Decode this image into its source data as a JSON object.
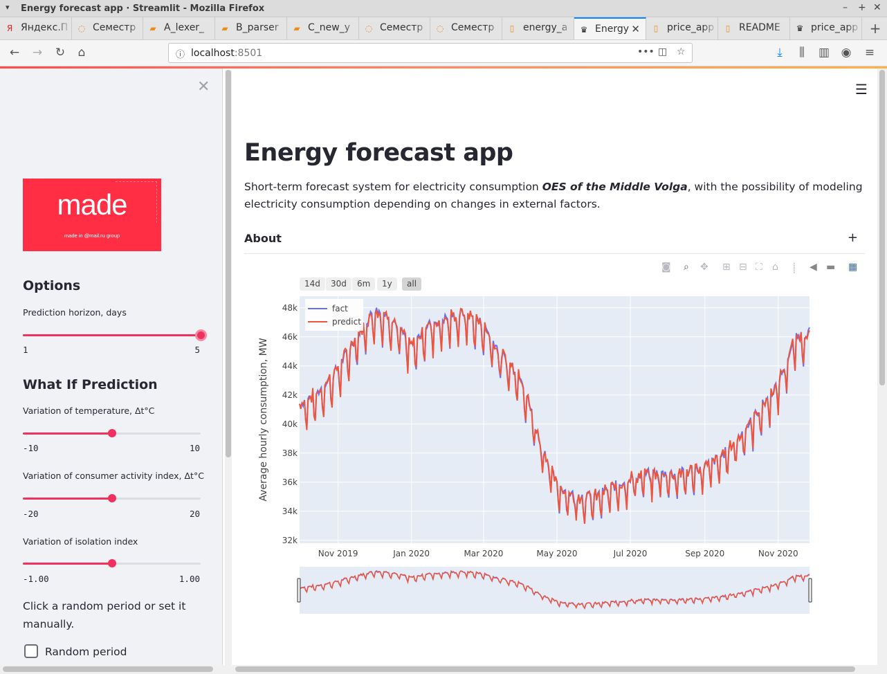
{
  "window": {
    "title": "Energy forecast app · Streamlit - Mozilla Firefox"
  },
  "tabs": [
    {
      "label": "Яндекс.П",
      "icon": "yandex-icon"
    },
    {
      "label": "Семестр",
      "icon": "page-icon"
    },
    {
      "label": "A_lexer_",
      "icon": "book-icon"
    },
    {
      "label": "B_parser",
      "icon": "book-icon"
    },
    {
      "label": "C_new_y",
      "icon": "book-icon"
    },
    {
      "label": "Семестр",
      "icon": "page-icon"
    },
    {
      "label": "Семестр",
      "icon": "page-icon"
    },
    {
      "label": "energy_a",
      "icon": "doc-icon"
    },
    {
      "label": "Energy",
      "icon": "streamlit-icon",
      "active": true
    },
    {
      "label": "price_app",
      "icon": "doc-icon"
    },
    {
      "label": "README",
      "icon": "doc-icon"
    },
    {
      "label": "price_app",
      "icon": "streamlit-icon"
    }
  ],
  "url": {
    "host": "localhost",
    "port": ":8501"
  },
  "sidebar": {
    "logo": {
      "word": "made",
      "sub": "made in @mail.ru group"
    },
    "options_heading": "Options",
    "horizon": {
      "label": "Prediction horizon, days",
      "min": "1",
      "max": "5",
      "value": 5,
      "lo": 1,
      "hi": 5
    },
    "whatif_heading": "What If Prediction",
    "temperature": {
      "label": "Variation of temperature, Δt°C",
      "min": "-10",
      "max": "10",
      "value": 0,
      "lo": -10,
      "hi": 10
    },
    "activity": {
      "label": "Variation of consumer activity index, Δt°C",
      "min": "-20",
      "max": "20",
      "value": 0,
      "lo": -20,
      "hi": 20
    },
    "isolation": {
      "label": "Variation of isolation index",
      "min": "-1.00",
      "max": "1.00",
      "value": 0,
      "lo": -1,
      "hi": 1
    },
    "period_text": "Click a random period or set it manually.",
    "random_period": "Random period"
  },
  "main": {
    "title": "Energy forecast app",
    "intro_pre": "Short-term forecast system for electricity consumption ",
    "intro_bold": "OES of the Middle Volga",
    "intro_post": ", with the possibility of modeling electricity consumption depending on changes in external factors.",
    "about_label": "About",
    "about_toggle": "+",
    "range_buttons": [
      {
        "label": "14d"
      },
      {
        "label": "30d"
      },
      {
        "label": "6m"
      },
      {
        "label": "1y"
      },
      {
        "label": "all",
        "active": true
      }
    ]
  },
  "chart_data": {
    "type": "line",
    "title": "",
    "xlabel": "",
    "ylabel": "Average hourly consumption, MW",
    "legend": "top-left",
    "grid": true,
    "ylim": [
      31800,
      48800
    ],
    "xlim": [
      "2019-09-30",
      "2020-11-27"
    ],
    "x_ticks": [
      "2019-11-01",
      "2020-01-01",
      "2020-03-01",
      "2020-05-01",
      "2020-07-01",
      "2020-09-01",
      "2020-11-01"
    ],
    "x_tick_labels": [
      "Nov 2019",
      "Jan 2020",
      "Mar 2020",
      "May 2020",
      "Jul 2020",
      "Sep 2020",
      "Nov 2020"
    ],
    "y_ticks": [
      32000,
      34000,
      36000,
      38000,
      40000,
      42000,
      44000,
      46000,
      48000
    ],
    "y_tick_labels": [
      "32k",
      "34k",
      "36k",
      "38k",
      "40k",
      "42k",
      "44k",
      "46k",
      "48k"
    ],
    "range_slider": true,
    "series": [
      {
        "name": "fact",
        "color": "#636efa"
      },
      {
        "name": "predict",
        "color": "#ef553b"
      }
    ],
    "x": [
      "2019-09-30",
      "2019-10-15",
      "2019-11-01",
      "2019-11-15",
      "2019-12-01",
      "2019-12-15",
      "2020-01-01",
      "2020-01-15",
      "2020-02-01",
      "2020-02-15",
      "2020-03-01",
      "2020-03-15",
      "2020-04-01",
      "2020-04-15",
      "2020-05-01",
      "2020-05-15",
      "2020-06-01",
      "2020-06-15",
      "2020-07-01",
      "2020-07-15",
      "2020-08-01",
      "2020-08-15",
      "2020-09-01",
      "2020-09-15",
      "2020-10-01",
      "2020-10-15",
      "2020-11-01",
      "2020-11-15",
      "2020-11-27"
    ],
    "weekly_trend": [
      41000,
      41800,
      43500,
      45500,
      47500,
      47000,
      45000,
      46500,
      47000,
      47300,
      46500,
      44500,
      43000,
      39000,
      35500,
      34800,
      34700,
      35300,
      36000,
      36300,
      36300,
      36400,
      36800,
      37500,
      39000,
      40500,
      42500,
      45500,
      46000
    ]
  }
}
